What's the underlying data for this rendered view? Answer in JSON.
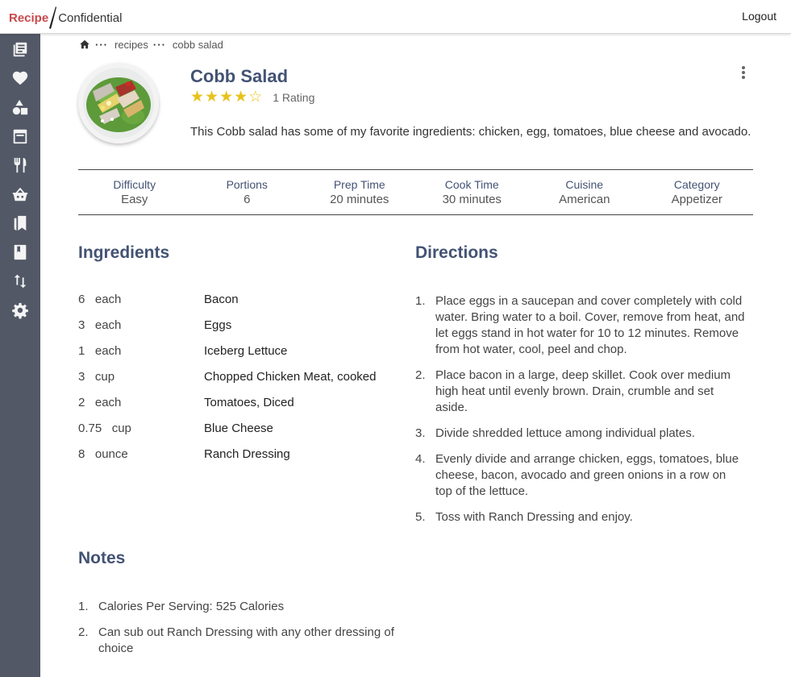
{
  "header": {
    "brand_left": "Recipe",
    "brand_right": "Confidential",
    "logout_label": "Logout"
  },
  "sidebar": {
    "items": [
      {
        "icon": "recipes-list-icon"
      },
      {
        "icon": "heart-icon"
      },
      {
        "icon": "shapes-icon"
      },
      {
        "icon": "calendar-icon"
      },
      {
        "icon": "utensils-icon"
      },
      {
        "icon": "shopping-basket-icon"
      },
      {
        "icon": "bookmarks-icon"
      },
      {
        "icon": "book-icon"
      },
      {
        "icon": "sort-arrows-icon"
      },
      {
        "icon": "gear-icon"
      }
    ]
  },
  "breadcrumb": {
    "items": [
      "recipes",
      "cobb salad"
    ]
  },
  "recipe": {
    "title": "Cobb Salad",
    "rating": 4,
    "rating_max": 5,
    "rating_count": "1 Rating",
    "description": "This Cobb salad has some of my favorite ingredients: chicken, egg, tomatoes, blue cheese and avocado."
  },
  "meta": [
    {
      "label": "Difficulty",
      "value": "Easy"
    },
    {
      "label": "Portions",
      "value": "6"
    },
    {
      "label": "Prep Time",
      "value": "20 minutes"
    },
    {
      "label": "Cook Time",
      "value": "30 minutes"
    },
    {
      "label": "Cuisine",
      "value": "American"
    },
    {
      "label": "Category",
      "value": "Appetizer"
    }
  ],
  "sections": {
    "ingredients": "Ingredients",
    "directions": "Directions",
    "notes": "Notes"
  },
  "ingredients": [
    {
      "qty": "6",
      "unit": "each",
      "name": "Bacon"
    },
    {
      "qty": "3",
      "unit": "each",
      "name": "Eggs"
    },
    {
      "qty": "1",
      "unit": "each",
      "name": "Iceberg Lettuce"
    },
    {
      "qty": "3",
      "unit": "cup",
      "name": "Chopped Chicken Meat, cooked"
    },
    {
      "qty": "2",
      "unit": "each",
      "name": "Tomatoes, Diced"
    },
    {
      "qty": "0.75",
      "unit": "cup",
      "name": "Blue Cheese"
    },
    {
      "qty": "8",
      "unit": "ounce",
      "name": "Ranch Dressing"
    }
  ],
  "directions": [
    {
      "num": "1.",
      "text": "Place eggs in a saucepan and cover completely with cold water. Bring water to a boil. Cover, remove from heat, and let eggs stand in hot water for 10 to 12 minutes. Remove from hot water, cool, peel and chop."
    },
    {
      "num": "2.",
      "text": "Place bacon in a large, deep skillet. Cook over medium high heat until evenly brown. Drain, crumble and set aside."
    },
    {
      "num": "3.",
      "text": "Divide shredded lettuce among individual plates."
    },
    {
      "num": "4.",
      "text": "Evenly divide and arrange chicken, eggs, tomatoes, blue cheese, bacon, avocado and green onions in a row on top of the lettuce."
    },
    {
      "num": "5.",
      "text": "Toss with Ranch Dressing and enjoy."
    }
  ],
  "notes": [
    {
      "num": "1.",
      "text": "Calories Per Serving: 525 Calories"
    },
    {
      "num": "2.",
      "text": "Can sub out Ranch Dressing with any other dressing of choice"
    }
  ],
  "colors": {
    "brand_red": "#c9484a",
    "heading_blue": "#435374",
    "sidebar": "#525866",
    "star": "#e8c21c"
  }
}
